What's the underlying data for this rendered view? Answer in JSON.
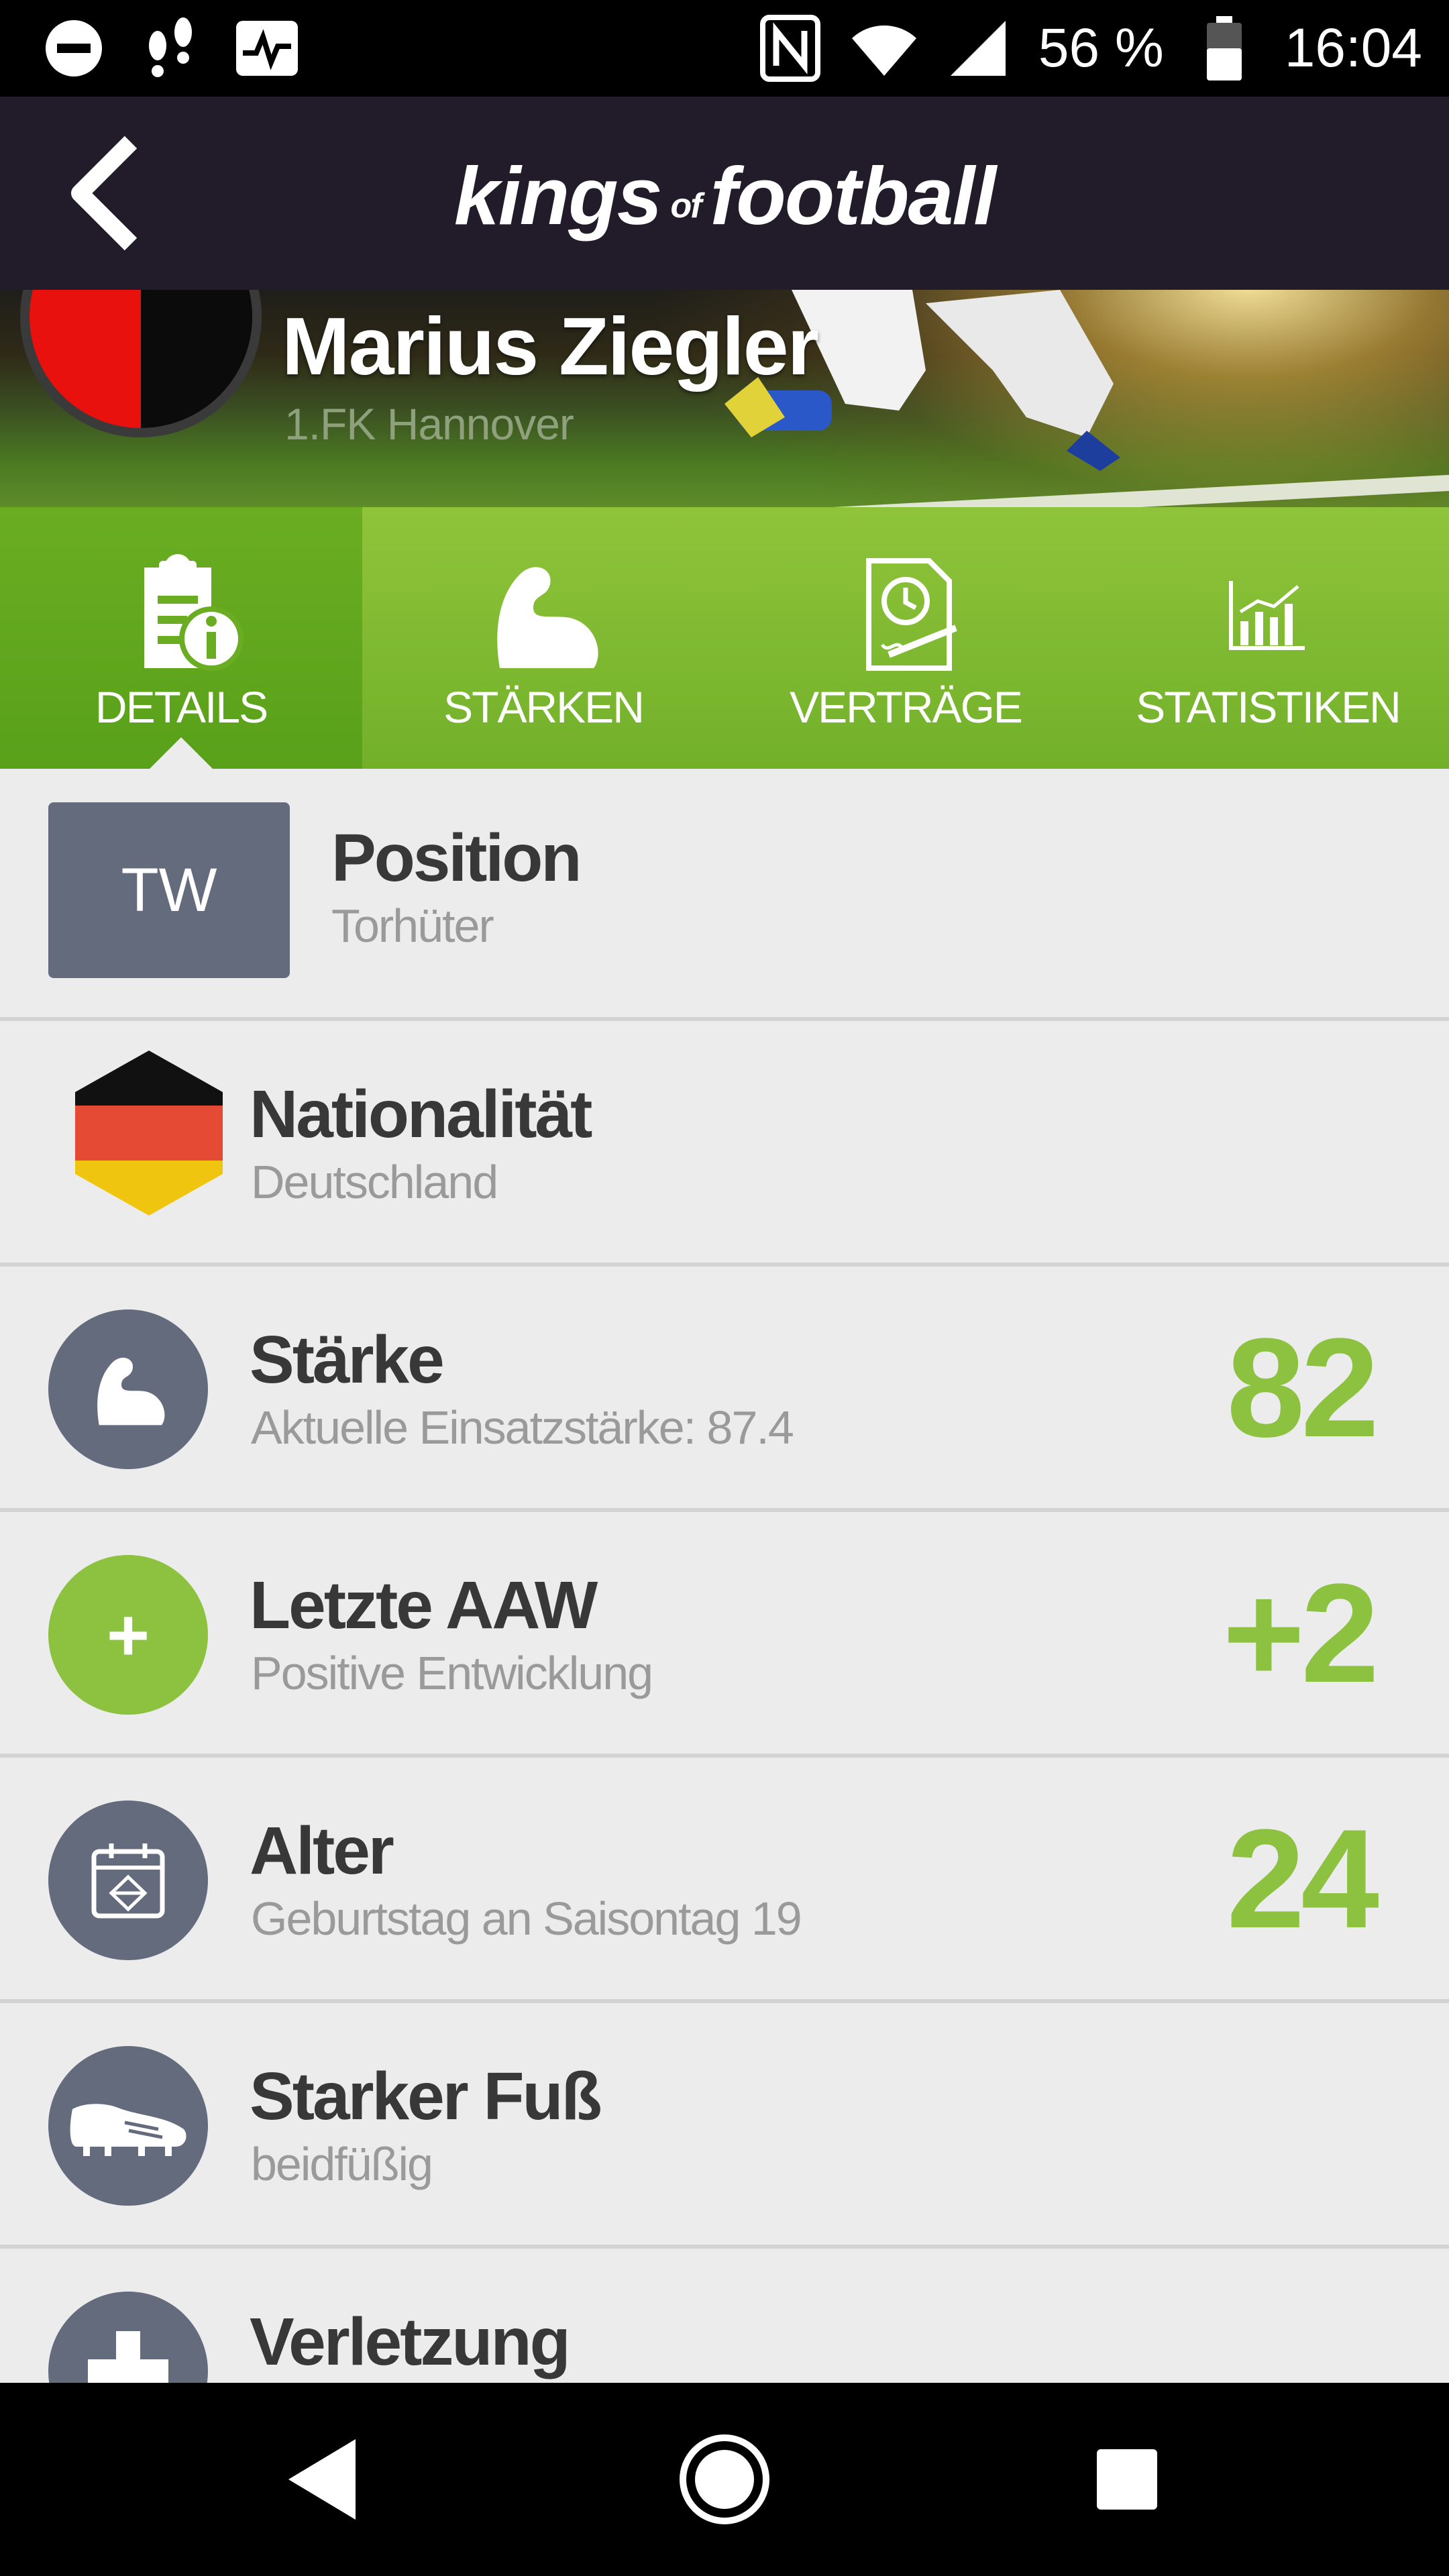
{
  "status_bar": {
    "battery": "56 %",
    "time": "16:04"
  },
  "header": {
    "logo_part1": "kings",
    "logo_part2": "of",
    "logo_part3": "football"
  },
  "player": {
    "name": "Marius Ziegler",
    "club": "1.FK Hannover"
  },
  "tabs": [
    {
      "label": "DETAILS",
      "icon": "clipboard-info-icon",
      "active": true
    },
    {
      "label": "STÄRKEN",
      "icon": "flexed-arm-icon",
      "active": false
    },
    {
      "label": "VERTRÄGE",
      "icon": "contract-icon",
      "active": false
    },
    {
      "label": "STATISTIKEN",
      "icon": "chart-icon",
      "active": false
    }
  ],
  "details": {
    "position": {
      "badge": "TW",
      "title": "Position",
      "subtitle": "Torhüter"
    },
    "nationality": {
      "title": "Nationalität",
      "subtitle": "Deutschland",
      "icon": "german-flag-icon"
    },
    "strength": {
      "title": "Stärke",
      "subtitle": "Aktuelle Einsatzstärke: 87.4",
      "value": "82",
      "icon": "flexed-arm-icon"
    },
    "last_aaw": {
      "title": "Letzte AAW",
      "subtitle": "Positive Entwicklung",
      "value": "+2",
      "icon_text": "+"
    },
    "age": {
      "title": "Alter",
      "subtitle": "Geburtstag an Saisontag 19",
      "value": "24",
      "icon": "calendar-icon"
    },
    "strong_foot": {
      "title": "Starker Fuß",
      "subtitle": "beidfüßig",
      "icon": "football-boot-icon"
    },
    "injury": {
      "title": "Verletzung",
      "icon": "medical-cross-icon"
    }
  },
  "colors": {
    "accent_green": "#8cc23f",
    "header_bg": "#221c2a",
    "icon_grey": "#636b7d"
  }
}
